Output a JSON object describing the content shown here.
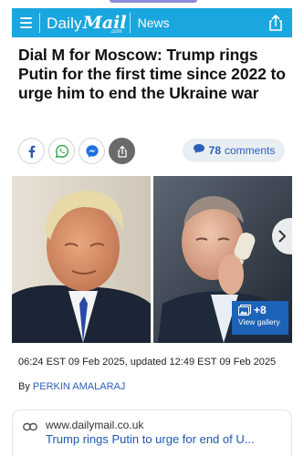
{
  "masthead": {
    "logo_daily": "Daily",
    "logo_mail": "Mail",
    "logo_com": ".com",
    "section": "News",
    "background": "#1aa6de"
  },
  "article": {
    "headline": "Dial M for Moscow: Trump rings Putin for the first time since 2022 to urge him to end the Ukraine war",
    "comments_count": "78",
    "comments_label": "comments",
    "published": "06:24 EST 09 Feb 2025, updated 12:49 EST 09 Feb 2025",
    "byline_prefix": "By",
    "author": "PERKIN AMALARAJ"
  },
  "social": {
    "icons": [
      "facebook-icon",
      "whatsapp-icon",
      "messenger-icon",
      "share-icon"
    ]
  },
  "gallery": {
    "extra_count": "+8",
    "view_label": "View gallery",
    "accent": "#1d63b7"
  },
  "link_preview": {
    "url": "www.dailymail.co.uk",
    "title": "Trump rings Putin to urge for end of U..."
  }
}
